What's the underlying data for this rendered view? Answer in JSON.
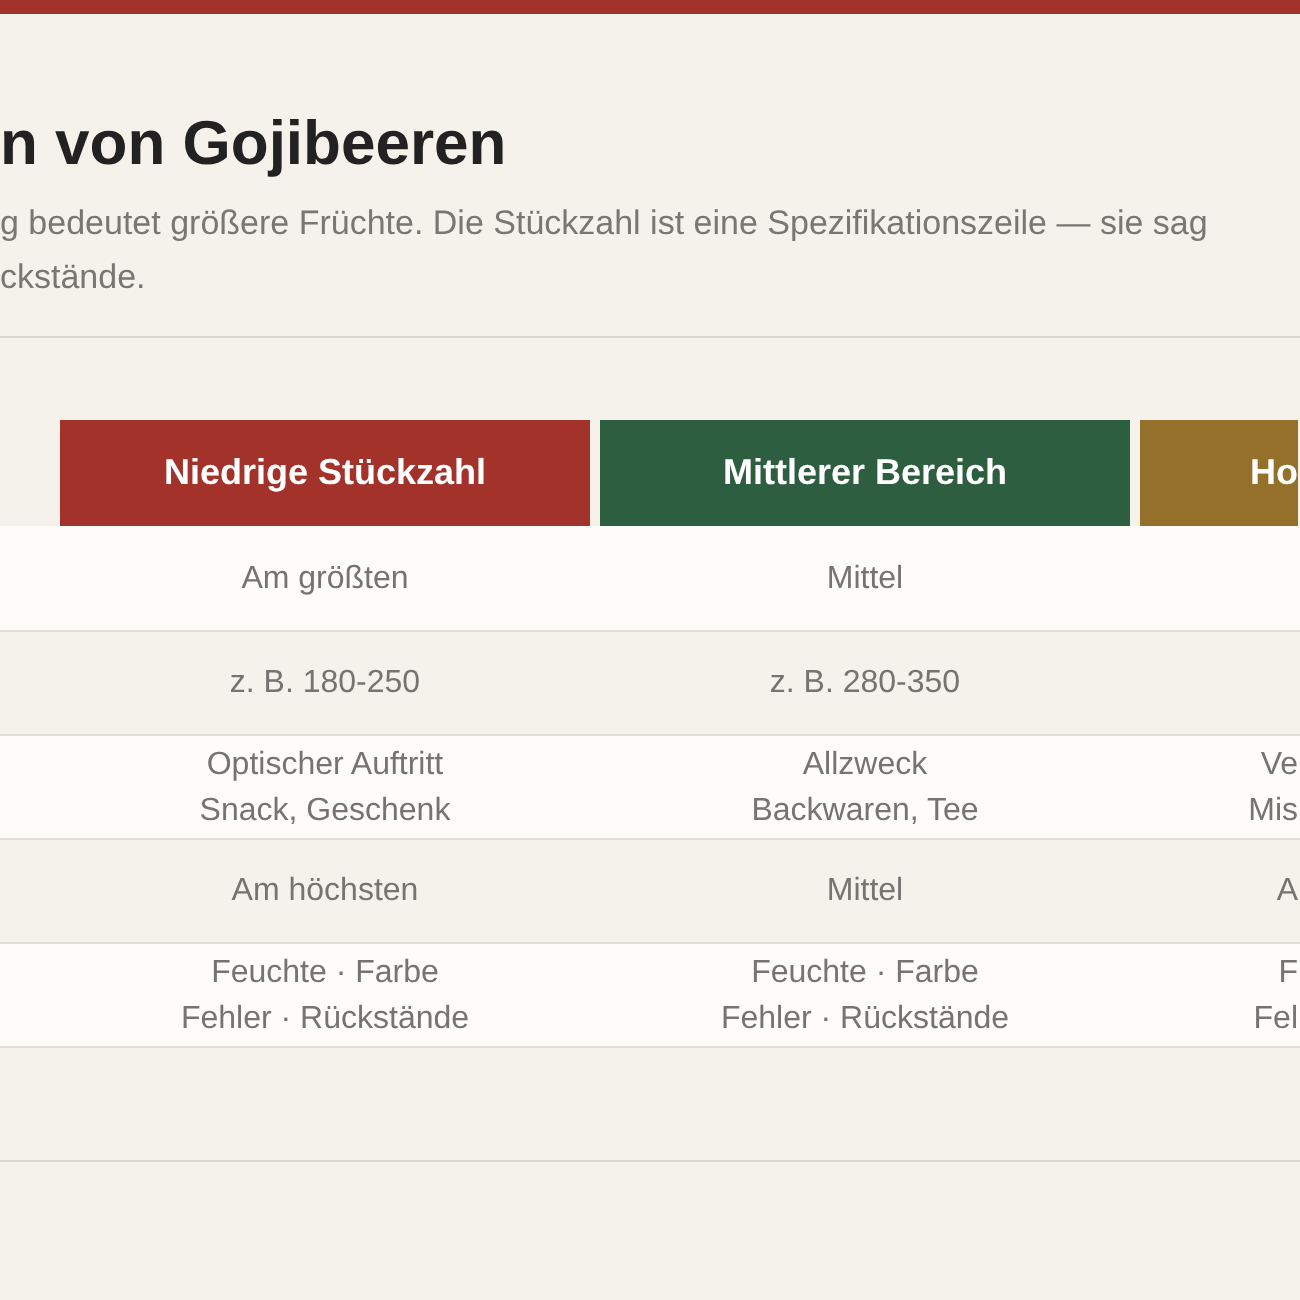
{
  "title": "n von Gojibeeren",
  "intro": [
    "g bedeutet größere Früchte. Die Stückzahl ist eine Spezifikationszeile — sie sag",
    "ckstände."
  ],
  "table": {
    "columns": [
      {
        "label": "Niedrige Stückzahl",
        "color": "#a3322a"
      },
      {
        "label": "Mittlerer Bereich",
        "color": "#2e5e40"
      },
      {
        "label": "Ho",
        "color": "#94702a"
      }
    ],
    "rows": [
      {
        "cells": [
          [
            "Am größten"
          ],
          [
            "Mittel"
          ]
        ]
      },
      {
        "cells": [
          [
            "z. B. 180-250"
          ],
          [
            "z. B. 280-350"
          ]
        ]
      },
      {
        "cells": [
          [
            "Optischer Auftritt",
            "Snack, Geschenk"
          ],
          [
            "Allzweck",
            "Backwaren, Tee"
          ],
          [
            "Ve",
            "Mis"
          ]
        ]
      },
      {
        "cells": [
          [
            "Am höchsten"
          ],
          [
            "Mittel"
          ],
          [
            "A"
          ]
        ]
      },
      {
        "cells": [
          [
            "Feuchte · Farbe",
            "Fehler · Rückstände"
          ],
          [
            "Feuchte · Farbe",
            "Fehler · Rückstände"
          ],
          [
            "F",
            "Fel"
          ]
        ]
      }
    ]
  }
}
